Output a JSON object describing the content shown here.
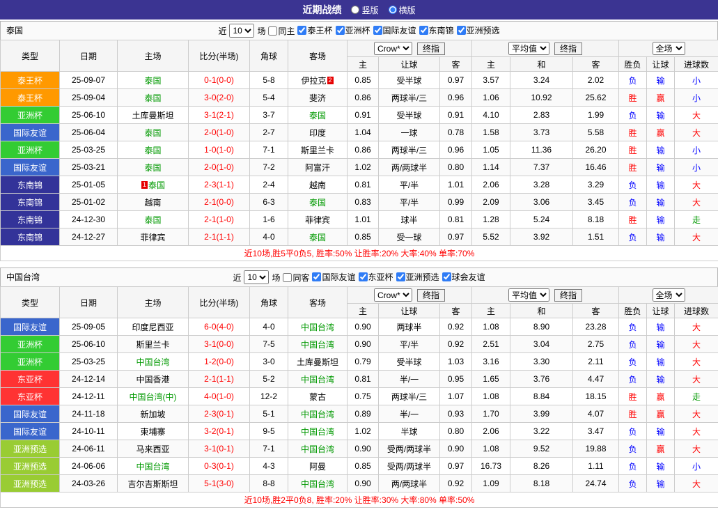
{
  "header": {
    "title": "近期战绩",
    "vertical": "竖版",
    "horizontal": "横版"
  },
  "labels": {
    "near": "近",
    "games": "场"
  },
  "controls": {
    "bookmaker": "Crow*",
    "final": "终指",
    "average": "平均值",
    "full": "全场"
  },
  "columns": {
    "type": "类型",
    "date": "日期",
    "home": "主场",
    "score": "比分(半场)",
    "corner": "角球",
    "away": "客场",
    "home_odds": "主",
    "handicap": "让球",
    "away_odds": "客",
    "avg_home": "主",
    "avg_draw": "和",
    "avg_away": "客",
    "wl": "胜负",
    "handicap_result": "让球",
    "goals": "进球数"
  },
  "type_colors": {
    "泰王杯": "#ff9900",
    "亚洲杯": "#33cc33",
    "国际友谊": "#3a66cc",
    "东南锦": "#333399",
    "东亚杯": "#ff3333",
    "亚洲预选": "#99cc33"
  },
  "result_colors": {
    "red": "#ff0000",
    "blue": "#0000ff",
    "green": "#009900"
  },
  "sections": [
    {
      "team": "泰国",
      "filter": {
        "count": "10",
        "same_label": "同主",
        "competitions": [
          "泰王杯",
          "亚洲杯",
          "国际友谊",
          "东南锦",
          "亚洲预选"
        ]
      },
      "rows": [
        {
          "type": "泰王杯",
          "date": "25-09-07",
          "home": {
            "text": "泰国",
            "green": true
          },
          "score": "0-1(0-0)",
          "corner": "5-8",
          "away": {
            "text": "伊拉克",
            "badge_after": "2"
          },
          "odds": [
            "0.85",
            "受半球",
            "0.97"
          ],
          "avg": [
            "3.57",
            "3.24",
            "2.02"
          ],
          "results": [
            [
              "负",
              "blue"
            ],
            [
              "输",
              "blue"
            ],
            [
              "小",
              "blue"
            ]
          ]
        },
        {
          "type": "泰王杯",
          "date": "25-09-04",
          "home": {
            "text": "泰国",
            "green": true
          },
          "score": "3-0(2-0)",
          "corner": "5-4",
          "away": {
            "text": "斐济"
          },
          "odds": [
            "0.86",
            "两球半/三",
            "0.96"
          ],
          "avg": [
            "1.06",
            "10.92",
            "25.62"
          ],
          "results": [
            [
              "胜",
              "red"
            ],
            [
              "赢",
              "red"
            ],
            [
              "小",
              "blue"
            ]
          ]
        },
        {
          "type": "亚洲杯",
          "date": "25-06-10",
          "home": {
            "text": "土库曼斯坦"
          },
          "score": "3-1(2-1)",
          "corner": "3-7",
          "away": {
            "text": "泰国",
            "green": true
          },
          "odds": [
            "0.91",
            "受半球",
            "0.91"
          ],
          "avg": [
            "4.10",
            "2.83",
            "1.99"
          ],
          "results": [
            [
              "负",
              "blue"
            ],
            [
              "输",
              "blue"
            ],
            [
              "大",
              "red"
            ]
          ]
        },
        {
          "type": "国际友谊",
          "date": "25-06-04",
          "home": {
            "text": "泰国",
            "green": true
          },
          "score": "2-0(1-0)",
          "corner": "2-7",
          "away": {
            "text": "印度"
          },
          "odds": [
            "1.04",
            "一球",
            "0.78"
          ],
          "avg": [
            "1.58",
            "3.73",
            "5.58"
          ],
          "results": [
            [
              "胜",
              "red"
            ],
            [
              "赢",
              "red"
            ],
            [
              "大",
              "red"
            ]
          ]
        },
        {
          "type": "亚洲杯",
          "date": "25-03-25",
          "home": {
            "text": "泰国",
            "green": true
          },
          "score": "1-0(1-0)",
          "corner": "7-1",
          "away": {
            "text": "斯里兰卡"
          },
          "odds": [
            "0.86",
            "两球半/三",
            "0.96"
          ],
          "avg": [
            "1.05",
            "11.36",
            "26.20"
          ],
          "results": [
            [
              "胜",
              "red"
            ],
            [
              "输",
              "blue"
            ],
            [
              "小",
              "blue"
            ]
          ]
        },
        {
          "type": "国际友谊",
          "date": "25-03-21",
          "home": {
            "text": "泰国",
            "green": true
          },
          "score": "2-0(1-0)",
          "corner": "7-2",
          "away": {
            "text": "阿富汗"
          },
          "odds": [
            "1.02",
            "两/两球半",
            "0.80"
          ],
          "avg": [
            "1.14",
            "7.37",
            "16.46"
          ],
          "results": [
            [
              "胜",
              "red"
            ],
            [
              "输",
              "blue"
            ],
            [
              "小",
              "blue"
            ]
          ]
        },
        {
          "type": "东南锦",
          "date": "25-01-05",
          "home": {
            "text": "泰国",
            "green": true,
            "badge_before": "1"
          },
          "score": "2-3(1-1)",
          "corner": "2-4",
          "away": {
            "text": "越南"
          },
          "odds": [
            "0.81",
            "平/半",
            "1.01"
          ],
          "avg": [
            "2.06",
            "3.28",
            "3.29"
          ],
          "results": [
            [
              "负",
              "blue"
            ],
            [
              "输",
              "blue"
            ],
            [
              "大",
              "red"
            ]
          ]
        },
        {
          "type": "东南锦",
          "date": "25-01-02",
          "home": {
            "text": "越南"
          },
          "score": "2-1(0-0)",
          "corner": "6-3",
          "away": {
            "text": "泰国",
            "green": true
          },
          "odds": [
            "0.83",
            "平/半",
            "0.99"
          ],
          "avg": [
            "2.09",
            "3.06",
            "3.45"
          ],
          "results": [
            [
              "负",
              "blue"
            ],
            [
              "输",
              "blue"
            ],
            [
              "大",
              "red"
            ]
          ]
        },
        {
          "type": "东南锦",
          "date": "24-12-30",
          "home": {
            "text": "泰国",
            "green": true
          },
          "score": "2-1(1-0)",
          "corner": "1-6",
          "away": {
            "text": "菲律宾"
          },
          "odds": [
            "1.01",
            "球半",
            "0.81"
          ],
          "avg": [
            "1.28",
            "5.24",
            "8.18"
          ],
          "results": [
            [
              "胜",
              "red"
            ],
            [
              "输",
              "blue"
            ],
            [
              "走",
              "green"
            ]
          ]
        },
        {
          "type": "东南锦",
          "date": "24-12-27",
          "home": {
            "text": "菲律宾"
          },
          "score": "2-1(1-1)",
          "corner": "4-0",
          "away": {
            "text": "泰国",
            "green": true
          },
          "odds": [
            "0.85",
            "受一球",
            "0.97"
          ],
          "avg": [
            "5.52",
            "3.92",
            "1.51"
          ],
          "results": [
            [
              "负",
              "blue"
            ],
            [
              "输",
              "blue"
            ],
            [
              "大",
              "red"
            ]
          ]
        }
      ],
      "summary": "近10场,胜5平0负5, 胜率:50% 让胜率:20% 大率:40% 单率:70%"
    },
    {
      "team": "中国台湾",
      "filter": {
        "count": "10",
        "same_label": "同客",
        "competitions": [
          "国际友谊",
          "东亚杯",
          "亚洲预选",
          "球会友谊"
        ]
      },
      "rows": [
        {
          "type": "国际友谊",
          "date": "25-09-05",
          "home": {
            "text": "印度尼西亚"
          },
          "score": "6-0(4-0)",
          "corner": "4-0",
          "away": {
            "text": "中国台湾",
            "green": true
          },
          "odds": [
            "0.90",
            "两球半",
            "0.92"
          ],
          "avg": [
            "1.08",
            "8.90",
            "23.28"
          ],
          "results": [
            [
              "负",
              "blue"
            ],
            [
              "输",
              "blue"
            ],
            [
              "大",
              "red"
            ]
          ]
        },
        {
          "type": "亚洲杯",
          "date": "25-06-10",
          "home": {
            "text": "斯里兰卡"
          },
          "score": "3-1(0-0)",
          "corner": "7-5",
          "away": {
            "text": "中国台湾",
            "green": true
          },
          "odds": [
            "0.90",
            "平/半",
            "0.92"
          ],
          "avg": [
            "2.51",
            "3.04",
            "2.75"
          ],
          "results": [
            [
              "负",
              "blue"
            ],
            [
              "输",
              "blue"
            ],
            [
              "大",
              "red"
            ]
          ]
        },
        {
          "type": "亚洲杯",
          "date": "25-03-25",
          "home": {
            "text": "中国台湾",
            "green": true
          },
          "score": "1-2(0-0)",
          "corner": "3-0",
          "away": {
            "text": "土库曼斯坦"
          },
          "odds": [
            "0.79",
            "受半球",
            "1.03"
          ],
          "avg": [
            "3.16",
            "3.30",
            "2.11"
          ],
          "results": [
            [
              "负",
              "blue"
            ],
            [
              "输",
              "blue"
            ],
            [
              "大",
              "red"
            ]
          ]
        },
        {
          "type": "东亚杯",
          "date": "24-12-14",
          "home": {
            "text": "中国香港"
          },
          "score": "2-1(1-1)",
          "corner": "5-2",
          "away": {
            "text": "中国台湾",
            "green": true
          },
          "odds": [
            "0.81",
            "半/一",
            "0.95"
          ],
          "avg": [
            "1.65",
            "3.76",
            "4.47"
          ],
          "results": [
            [
              "负",
              "blue"
            ],
            [
              "输",
              "blue"
            ],
            [
              "大",
              "red"
            ]
          ]
        },
        {
          "type": "东亚杯",
          "date": "24-12-11",
          "home": {
            "text": "中国台湾(中)",
            "green": true
          },
          "score": "4-0(1-0)",
          "corner": "12-2",
          "away": {
            "text": "蒙古"
          },
          "odds": [
            "0.75",
            "两球半/三",
            "1.07"
          ],
          "avg": [
            "1.08",
            "8.84",
            "18.15"
          ],
          "results": [
            [
              "胜",
              "red"
            ],
            [
              "赢",
              "red"
            ],
            [
              "走",
              "green"
            ]
          ]
        },
        {
          "type": "国际友谊",
          "date": "24-11-18",
          "home": {
            "text": "新加坡"
          },
          "score": "2-3(0-1)",
          "corner": "5-1",
          "away": {
            "text": "中国台湾",
            "green": true
          },
          "odds": [
            "0.89",
            "半/一",
            "0.93"
          ],
          "avg": [
            "1.70",
            "3.99",
            "4.07"
          ],
          "results": [
            [
              "胜",
              "red"
            ],
            [
              "赢",
              "red"
            ],
            [
              "大",
              "red"
            ]
          ]
        },
        {
          "type": "国际友谊",
          "date": "24-10-11",
          "home": {
            "text": "柬埔寨"
          },
          "score": "3-2(0-1)",
          "corner": "9-5",
          "away": {
            "text": "中国台湾",
            "green": true
          },
          "odds": [
            "1.02",
            "半球",
            "0.80"
          ],
          "avg": [
            "2.06",
            "3.22",
            "3.47"
          ],
          "results": [
            [
              "负",
              "blue"
            ],
            [
              "输",
              "blue"
            ],
            [
              "大",
              "red"
            ]
          ]
        },
        {
          "type": "亚洲预选",
          "date": "24-06-11",
          "home": {
            "text": "马来西亚"
          },
          "score": "3-1(0-1)",
          "corner": "7-1",
          "away": {
            "text": "中国台湾",
            "green": true
          },
          "odds": [
            "0.90",
            "受两/两球半",
            "0.90"
          ],
          "avg": [
            "1.08",
            "9.52",
            "19.88"
          ],
          "results": [
            [
              "负",
              "blue"
            ],
            [
              "赢",
              "red"
            ],
            [
              "大",
              "red"
            ]
          ]
        },
        {
          "type": "亚洲预选",
          "date": "24-06-06",
          "home": {
            "text": "中国台湾",
            "green": true
          },
          "score": "0-3(0-1)",
          "corner": "4-3",
          "away": {
            "text": "阿曼"
          },
          "odds": [
            "0.85",
            "受两/两球半",
            "0.97"
          ],
          "avg": [
            "16.73",
            "8.26",
            "1.11"
          ],
          "results": [
            [
              "负",
              "blue"
            ],
            [
              "输",
              "blue"
            ],
            [
              "小",
              "blue"
            ]
          ]
        },
        {
          "type": "亚洲预选",
          "date": "24-03-26",
          "home": {
            "text": "吉尔吉斯斯坦"
          },
          "score": "5-1(3-0)",
          "corner": "8-8",
          "away": {
            "text": "中国台湾",
            "green": true
          },
          "odds": [
            "0.90",
            "两/两球半",
            "0.92"
          ],
          "avg": [
            "1.09",
            "8.18",
            "24.74"
          ],
          "results": [
            [
              "负",
              "blue"
            ],
            [
              "输",
              "blue"
            ],
            [
              "大",
              "red"
            ]
          ]
        }
      ],
      "summary": "近10场,胜2平0负8, 胜率:20% 让胜率:30% 大率:80% 单率:50%"
    }
  ]
}
